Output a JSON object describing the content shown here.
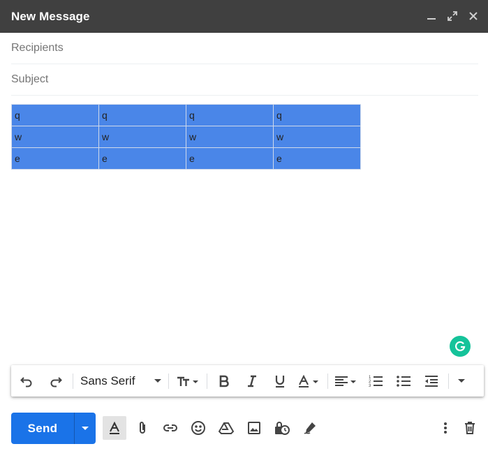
{
  "window": {
    "title": "New Message",
    "controls": [
      "minimize-icon",
      "expand-icon",
      "close-icon"
    ]
  },
  "recipients": {
    "placeholder": "Recipients",
    "value": ""
  },
  "subject": {
    "placeholder": "Subject",
    "value": ""
  },
  "body_table": {
    "background": "#4a86e8",
    "rows": [
      [
        "q",
        "q",
        "q",
        "q"
      ],
      [
        "w",
        "w",
        "w",
        "w"
      ],
      [
        "e",
        "e",
        "e",
        "e"
      ]
    ]
  },
  "grammarly": {
    "icon": "grammarly-icon",
    "color": "#15c39a"
  },
  "formatting": {
    "font_family": "Sans Serif",
    "items": [
      "undo-icon",
      "redo-icon",
      "font-select",
      "text-size-icon",
      "bold-icon",
      "italic-icon",
      "underline-icon",
      "text-color-icon",
      "align-icon",
      "numbered-list-icon",
      "bulleted-list-icon",
      "indent-less-icon",
      "more-formatting-icon"
    ]
  },
  "bottom": {
    "send_label": "Send",
    "accent": "#1a73e8",
    "icons": [
      "formatting-options-icon",
      "attach-icon",
      "link-icon",
      "emoji-icon",
      "drive-icon",
      "photo-icon",
      "confidential-mode-icon",
      "signature-icon",
      "more-options-icon",
      "discard-icon"
    ]
  }
}
